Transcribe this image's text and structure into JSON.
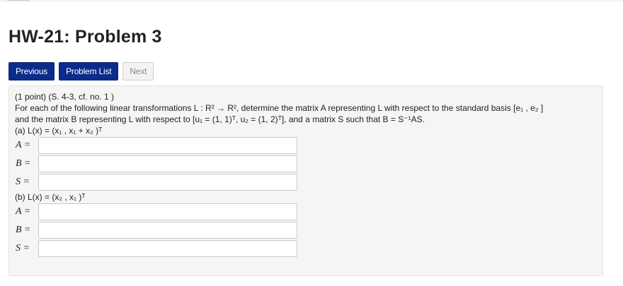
{
  "page": {
    "title": "HW-21: Problem 3"
  },
  "nav": {
    "previous_label": "Previous",
    "problem_list_label": "Problem List",
    "next_label": "Next"
  },
  "problem": {
    "header": "(1 point) (S. 4-3, cf. no. 1 )",
    "intro": "For each of the following linear transformations L : R² → R², determine the matrix A representing L with respect to the standard basis [e₁ , e₂ ]",
    "intro2": "and the matrix B representing L with respect to [u₁ = (1, 1)ᵀ, u₂ = (1, 2)ᵀ], and a matrix S such that B = S⁻¹AS.",
    "part_a": "(a) L(x) = (x₁ , x₁ + x₂ )ᵀ",
    "part_b": "(b) L(x) = (x₂ , x₁ )ᵀ",
    "labels": {
      "a": "A =",
      "b": "B =",
      "s": "S ="
    },
    "answers": {
      "a_A": "",
      "a_B": "",
      "a_S": "",
      "b_A": "",
      "b_B": "",
      "b_S": ""
    }
  }
}
